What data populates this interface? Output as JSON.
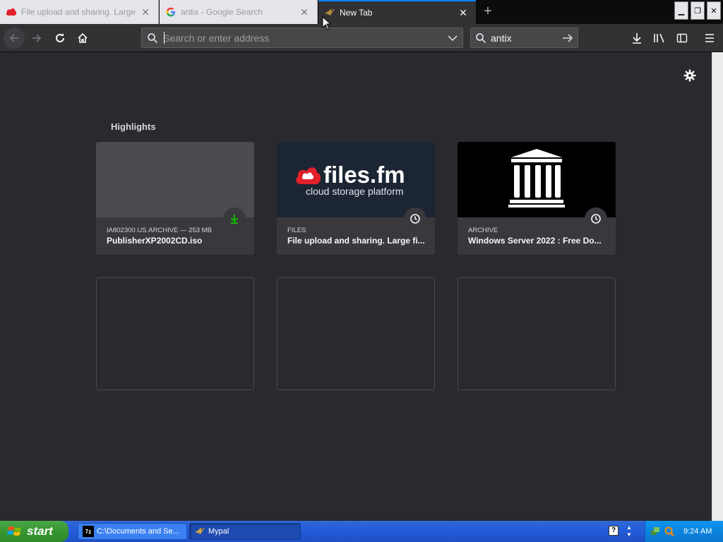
{
  "tabs": [
    {
      "title": "File upload and sharing. Large fi",
      "favicon": "filesfm-cloud-icon",
      "active": false
    },
    {
      "title": "antix - Google Search",
      "favicon": "google-g-icon",
      "active": false
    },
    {
      "title": "New Tab",
      "favicon": "mypal-bird-icon",
      "active": true
    }
  ],
  "toolbar": {
    "url_placeholder": "Search or enter address",
    "search_value": "antix"
  },
  "newtab": {
    "section_title": "Highlights",
    "cards": [
      {
        "context": "IA802300.US.ARCHIVE — 253 MB",
        "title": "PublisherXP2002CD.iso",
        "badge": "download-icon",
        "badge_color": "#12bc00"
      },
      {
        "context": "FILES",
        "title": "File upload and sharing. Large fi...",
        "badge": "clock-icon",
        "logo_text": "files.fm",
        "logo_sub": "cloud storage platform"
      },
      {
        "context": "ARCHIVE",
        "title": "Windows Server 2022 : Free Do...",
        "badge": "clock-icon"
      }
    ]
  },
  "taskbar": {
    "start_label": "start",
    "items": [
      {
        "label": "C:\\Documents and Se...",
        "icon": "7zip-icon"
      },
      {
        "label": "Mypal",
        "icon": "mypal-bird-icon"
      }
    ],
    "clock": "9:24 AM"
  },
  "colors": {
    "accent": "#0a84ff",
    "content_bg": "#2a2a2e",
    "card_bg": "#38383d"
  }
}
